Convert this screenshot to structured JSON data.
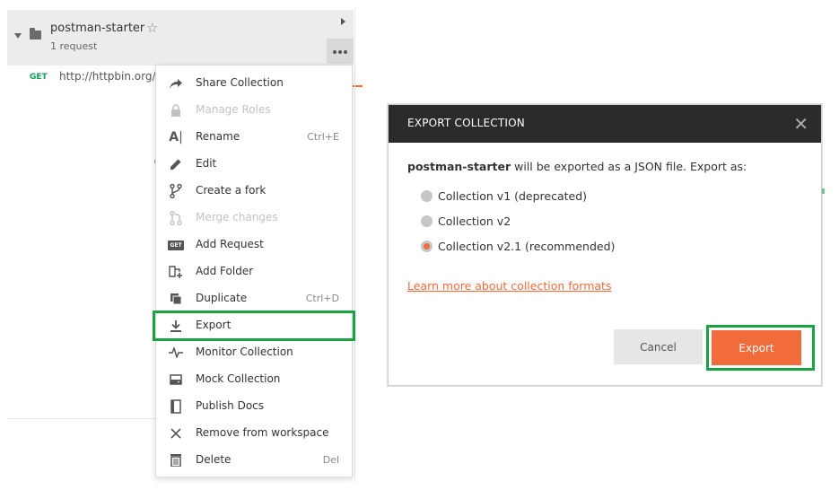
{
  "collection": {
    "name": "postman-starter",
    "count": "1 request"
  },
  "request": {
    "method": "GET",
    "url": "http://httpbin.org/b"
  },
  "menu": {
    "items": [
      {
        "label": "Share Collection",
        "shortcut": "",
        "icon": "share-icon",
        "disabled": false
      },
      {
        "label": "Manage Roles",
        "shortcut": "",
        "icon": "lock-icon",
        "disabled": true
      },
      {
        "label": "Rename",
        "shortcut": "Ctrl+E",
        "icon": "rename-icon",
        "disabled": false
      },
      {
        "label": "Edit",
        "shortcut": "",
        "icon": "pencil-icon",
        "disabled": false
      },
      {
        "label": "Create a fork",
        "shortcut": "",
        "icon": "fork-icon",
        "disabled": false
      },
      {
        "label": "Merge changes",
        "shortcut": "",
        "icon": "merge-icon",
        "disabled": true
      },
      {
        "label": "Add Request",
        "shortcut": "",
        "icon": "get-icon",
        "disabled": false
      },
      {
        "label": "Add Folder",
        "shortcut": "",
        "icon": "add-folder-icon",
        "disabled": false
      },
      {
        "label": "Duplicate",
        "shortcut": "Ctrl+D",
        "icon": "duplicate-icon",
        "disabled": false
      },
      {
        "label": "Export",
        "shortcut": "",
        "icon": "download-icon",
        "disabled": false
      },
      {
        "label": "Monitor Collection",
        "shortcut": "",
        "icon": "pulse-icon",
        "disabled": false
      },
      {
        "label": "Mock Collection",
        "shortcut": "",
        "icon": "server-icon",
        "disabled": false
      },
      {
        "label": "Publish Docs",
        "shortcut": "",
        "icon": "docs-icon",
        "disabled": false
      },
      {
        "label": "Remove from workspace",
        "shortcut": "",
        "icon": "close-icon",
        "disabled": false
      },
      {
        "label": "Delete",
        "shortcut": "Del",
        "icon": "trash-icon",
        "disabled": false
      }
    ],
    "get_icon_text": "GET"
  },
  "dialog": {
    "title": "EXPORT COLLECTION",
    "name": "postman-starter",
    "message": " will be exported as a JSON file. Export as:",
    "options": [
      {
        "label": "Collection v1 (deprecated)",
        "selected": false
      },
      {
        "label": "Collection v2",
        "selected": false
      },
      {
        "label": "Collection v2.1 (recommended)",
        "selected": true
      }
    ],
    "link": "Learn more about collection formats",
    "cancel_label": "Cancel",
    "export_label": "Export"
  },
  "colors": {
    "accent": "#f26b3a",
    "highlight": "#1aa245",
    "get_method": "#0c9f59",
    "dialog_header": "#2b2b2b"
  }
}
